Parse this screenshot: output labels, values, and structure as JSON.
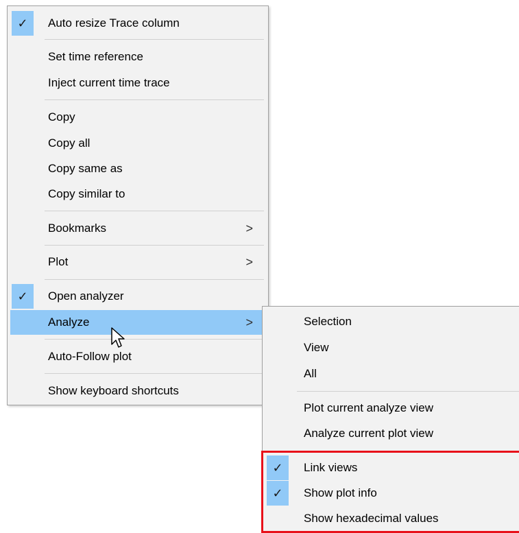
{
  "main_menu": {
    "items": [
      {
        "label": "Auto resize Trace column",
        "checked": true
      },
      {
        "label": "Set time reference"
      },
      {
        "label": "Inject current time trace"
      },
      {
        "label": "Copy"
      },
      {
        "label": "Copy all"
      },
      {
        "label": "Copy same as"
      },
      {
        "label": "Copy similar to"
      },
      {
        "label": "Bookmarks",
        "submenu": true
      },
      {
        "label": "Plot",
        "submenu": true
      },
      {
        "label": "Open analyzer",
        "checked": true
      },
      {
        "label": "Analyze",
        "submenu": true,
        "highlighted": true
      },
      {
        "label": "Auto-Follow plot"
      },
      {
        "label": "Show keyboard shortcuts"
      }
    ]
  },
  "analyze_submenu": {
    "items": [
      {
        "label": "Selection"
      },
      {
        "label": "View"
      },
      {
        "label": "All"
      },
      {
        "label": "Plot current analyze view"
      },
      {
        "label": "Analyze current plot view"
      },
      {
        "label": "Link views",
        "checked": true
      },
      {
        "label": "Show plot info",
        "checked": true
      },
      {
        "label": "Show hexadecimal values"
      }
    ]
  },
  "glyphs": {
    "check": "✓",
    "arrow": ">"
  },
  "colors": {
    "highlight": "#91c9f7",
    "menu_bg": "#f2f2f2",
    "annotation_red": "#e8101a"
  }
}
